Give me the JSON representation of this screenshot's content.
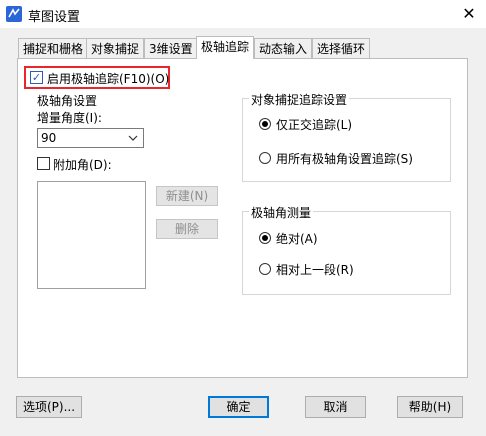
{
  "window": {
    "title": "草图设置",
    "close_glyph": "✕"
  },
  "tabs": [
    {
      "label": "捕捉和栅格"
    },
    {
      "label": "对象捕捉"
    },
    {
      "label": "3维设置"
    },
    {
      "label": "极轴追踪"
    },
    {
      "label": "动态输入"
    },
    {
      "label": "选择循环"
    }
  ],
  "polar": {
    "enable_label": "启用极轴追踪(F10)(O)",
    "enable_checked": true,
    "angle_group_title": "极轴角设置",
    "increment_label": "增量角度(I):",
    "increment_value": "90",
    "additional_label": "附加角(D):",
    "additional_checked": false,
    "new_button": "新建(N)",
    "delete_button": "删除"
  },
  "snap_tracking": {
    "group_title": "对象捕捉追踪设置",
    "option_ortho": "仅正交追踪(L)",
    "option_all": "用所有极轴角设置追踪(S)",
    "selected": "ortho"
  },
  "measurement": {
    "group_title": "极轴角测量",
    "option_absolute": "绝对(A)",
    "option_relative": "相对上一段(R)",
    "selected": "absolute"
  },
  "footer": {
    "options_button": "选项(P)...",
    "ok_button": "确定",
    "cancel_button": "取消",
    "help_button": "帮助(H)"
  },
  "colors": {
    "highlight": "#e8262c",
    "accent": "#2a5cba"
  }
}
